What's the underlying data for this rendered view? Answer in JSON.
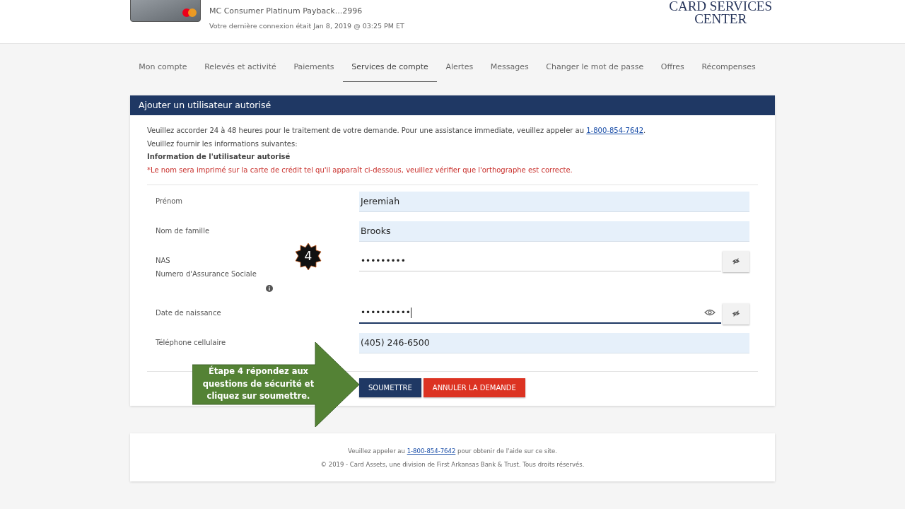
{
  "header": {
    "card_name": "MC Consumer Platinum Payback...2996",
    "last_login": "Votre dernière connexion était Jan 8, 2019 @ 03:25 PM ET",
    "logo_lines": [
      "CARD SERVICES",
      "CENTER"
    ]
  },
  "tabs": [
    {
      "label": "Mon compte",
      "selected": false
    },
    {
      "label": "Relevés et activité",
      "selected": false
    },
    {
      "label": "Paiements",
      "selected": false
    },
    {
      "label": "Services de compte",
      "selected": true
    },
    {
      "label": "Alertes",
      "selected": false
    },
    {
      "label": "Messages",
      "selected": false
    },
    {
      "label": "Changer le mot de passe",
      "selected": false
    },
    {
      "label": "Offres",
      "selected": false
    },
    {
      "label": "Récompenses",
      "selected": false
    }
  ],
  "panel": {
    "title": "Ajouter un utilisateur autorisé",
    "notice_before": "Veuillez accorder 24 à 48 heures pour le traitement de votre demande. Pour une assistance immediate, veuillez appeler au ",
    "notice_phone": "1-800-854-7642",
    "notice_after": ".",
    "instruction": "Veuillez fournir les informations suivantes:",
    "section_title": "Information de l'utilisateur autorisé",
    "warning": "*Le nom sera imprimé sur la carte de crédit tel qu'il apparaît ci-dessous, veuillez vérifier que l'orthographe est correcte.",
    "fields": [
      {
        "kind": "text",
        "label": "Prénom",
        "value": "Jeremiah"
      },
      {
        "kind": "text",
        "label": "Nom de famille",
        "value": "Brooks"
      },
      {
        "kind": "secret",
        "label": "NAS",
        "sublabel": "Numero d'Assurance Sociale",
        "value": "•••••••••",
        "focused": false,
        "info": true
      },
      {
        "kind": "secret",
        "label": "Date de naissance",
        "value": "••••••••••",
        "focused": true,
        "info": false
      },
      {
        "kind": "text",
        "label": "Téléphone cellulaire",
        "value": "(405) 246-6500"
      }
    ],
    "buttons": [
      {
        "kind": "primary",
        "label": "SOUMETTRE"
      },
      {
        "kind": "danger",
        "label": "ANNULER LA DEMANDE"
      }
    ]
  },
  "annotation": {
    "badge": "4",
    "callout": "Étape 4 répondez aux questions de sécurité et cliquez sur soumettre."
  },
  "footer": {
    "help_before": "Veuillez appeler au ",
    "help_phone": "1-800-854-7642",
    "help_after": " pour obtenir de l'aide sur ce site.",
    "copyright": "© 2019 - Card Assets, une division de First Arkansas Bank & Trust. Tous droits réservés."
  }
}
